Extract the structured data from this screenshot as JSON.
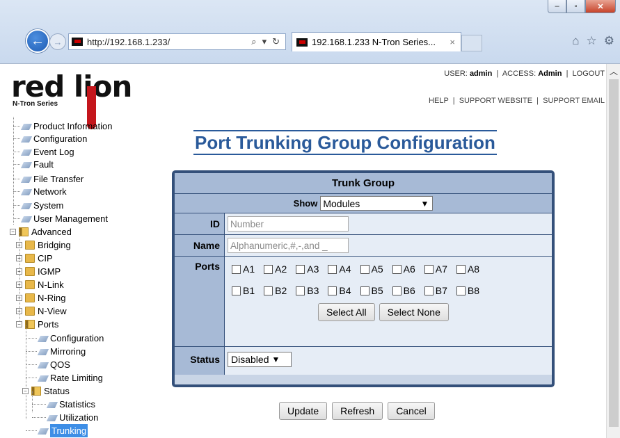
{
  "browser": {
    "address": "http://192.168.1.233/",
    "tab_title": "192.168.1.233 N-Tron Series...",
    "tab_close": "×",
    "min": "‒",
    "max": "▫",
    "close": "✕"
  },
  "header": {
    "logo_text": "red lion",
    "logo_sub": "N-Tron Series",
    "user_label": "USER:",
    "user": "admin",
    "access_label": "ACCESS:",
    "access": "Admin",
    "logout": "LOGOUT",
    "help": "HELP",
    "support_site": "SUPPORT WEBSITE",
    "support_email": "SUPPORT EMAIL",
    "sep": "|"
  },
  "tree": {
    "product_info": "Product Information",
    "configuration": "Configuration",
    "event_log": "Event Log",
    "fault": "Fault",
    "file_transfer": "File Transfer",
    "network": "Network",
    "system": "System",
    "user_mgmt": "User Management",
    "advanced": "Advanced",
    "bridging": "Bridging",
    "cip": "CIP",
    "igmp": "IGMP",
    "nlink": "N-Link",
    "nring": "N-Ring",
    "nview": "N-View",
    "ports": "Ports",
    "ports_config": "Configuration",
    "mirroring": "Mirroring",
    "qos": "QOS",
    "rate_limiting": "Rate Limiting",
    "status": "Status",
    "statistics": "Statistics",
    "utilization": "Utilization",
    "trunking": "Trunking"
  },
  "main": {
    "title": "Port Trunking Group Configuration",
    "group_header": "Trunk Group",
    "show_label": "Show",
    "show_value": "Modules",
    "id_label": "ID",
    "id_placeholder": "Number",
    "name_label": "Name",
    "name_placeholder": "Alphanumeric,#,-,and _",
    "ports_label": "Ports",
    "ports_a": [
      "A1",
      "A2",
      "A3",
      "A4",
      "A5",
      "A6",
      "A7",
      "A8"
    ],
    "ports_b": [
      "B1",
      "B2",
      "B3",
      "B4",
      "B5",
      "B6",
      "B7",
      "B8"
    ],
    "select_all": "Select All",
    "select_none": "Select None",
    "status_label": "Status",
    "status_value": "Disabled",
    "update": "Update",
    "refresh": "Refresh",
    "cancel": "Cancel"
  }
}
